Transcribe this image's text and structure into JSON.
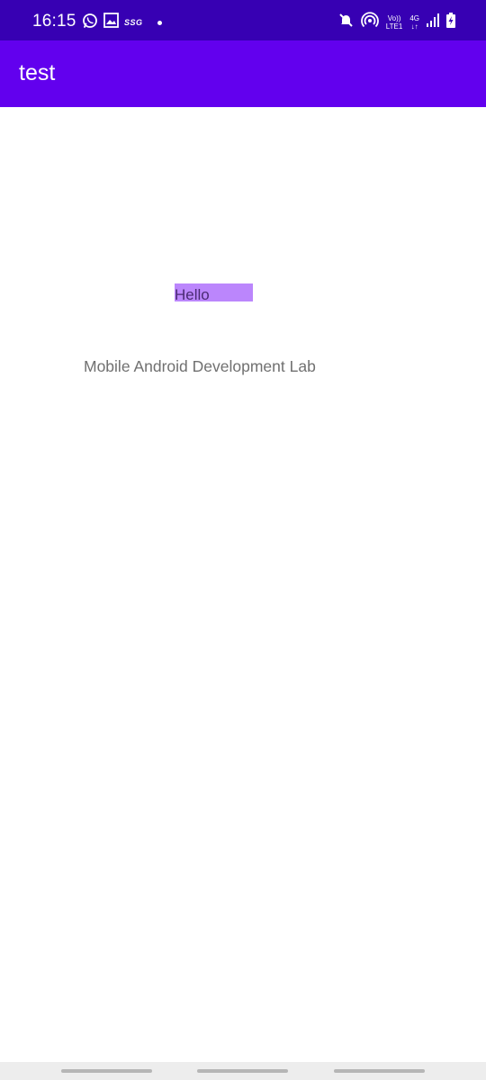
{
  "status_bar": {
    "time": "16:15",
    "ssg_label": "SSG",
    "volte_top": "Vo))",
    "volte_bottom": "LTE1",
    "network_top": "4G",
    "network_bottom": "↓↑",
    "colors": {
      "background": "#3700b3"
    },
    "icons": [
      "whatsapp-icon",
      "gallery-icon",
      "ssg-icon",
      "notification-dot-icon",
      "mute-icon",
      "hotspot-icon",
      "volte-icon",
      "network-4g-icon",
      "signal-icon",
      "battery-charging-icon"
    ]
  },
  "app_bar": {
    "title": "test",
    "colors": {
      "background": "#6200ee"
    }
  },
  "content": {
    "hello_text": "Hello",
    "lab_text": "Mobile Android Development Lab",
    "colors": {
      "hello_background": "#bb86fc"
    }
  },
  "nav_bar": {
    "items": [
      "recents-gesture",
      "home-gesture",
      "back-gesture"
    ]
  }
}
